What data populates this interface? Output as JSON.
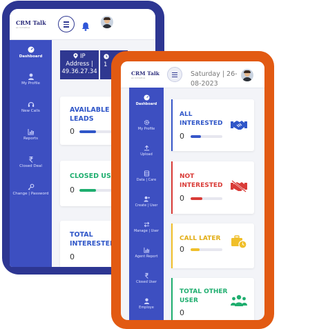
{
  "back": {
    "logo": "CRM Talk",
    "logo_tag": "an Initiative",
    "sidebar": [
      {
        "label": "Dashboard",
        "icon": "dashboard-icon",
        "active": true
      },
      {
        "label": "My Profile",
        "icon": "user-icon"
      },
      {
        "label": "New Calls",
        "icon": "headset-icon"
      },
      {
        "label": "Reports",
        "icon": "report-icon"
      },
      {
        "label": "Closed Deal",
        "icon": "rupee-icon"
      },
      {
        "label": "Change | Password",
        "icon": "key-icon"
      }
    ],
    "ip": {
      "line1": "IP",
      "line2": "Address |",
      "line3": "49.36.27.34",
      "next": "1"
    },
    "cards": [
      {
        "label": "AVAILABLE LEADS",
        "value": "0",
        "color": "#2f56c8"
      },
      {
        "label": "CLOSED USE",
        "value": "0",
        "color": "#1fae6f"
      },
      {
        "label": "TOTAL INTERESTED",
        "value": "0",
        "color": "#2f56c8"
      }
    ]
  },
  "front": {
    "logo": "CRM Talk",
    "logo_tag": "an Initiative",
    "date": "Saturday | 26-08-2023",
    "sidebar": [
      {
        "label": "Dashboard",
        "icon": "dashboard-icon",
        "active": true
      },
      {
        "label": "My Profile",
        "icon": "gear-icon"
      },
      {
        "label": "Upload",
        "icon": "upload-icon"
      },
      {
        "label": "Data | Care",
        "icon": "database-icon"
      },
      {
        "label": "Create | User",
        "icon": "user-plus-icon"
      },
      {
        "label": "Manage | User",
        "icon": "arrows-icon"
      },
      {
        "label": "Agent Report",
        "icon": "chart-icon"
      },
      {
        "label": "Closed User",
        "icon": "rupee-icon"
      },
      {
        "label": "Employe",
        "icon": "user-icon"
      }
    ],
    "cards": [
      {
        "label": "ALL INTERESTED",
        "value": "0",
        "color": "#3757c9",
        "icon": "handshake-icon",
        "icon_color": "#2f56c8"
      },
      {
        "label": "NOT INTERESTED",
        "value": "0",
        "color": "#d93b37",
        "icon": "no-deal-icon",
        "icon_color": "#d93b37"
      },
      {
        "label": "CALL LATER",
        "value": "0",
        "color": "#f0bf2a",
        "icon": "briefcase-clock-icon",
        "icon_color": "#f0bf2a"
      },
      {
        "label": "TOTAL OTHER USER",
        "value": "0",
        "color": "#1fae6f",
        "icon": "users-icon",
        "icon_color": "#1fae6f"
      }
    ]
  }
}
